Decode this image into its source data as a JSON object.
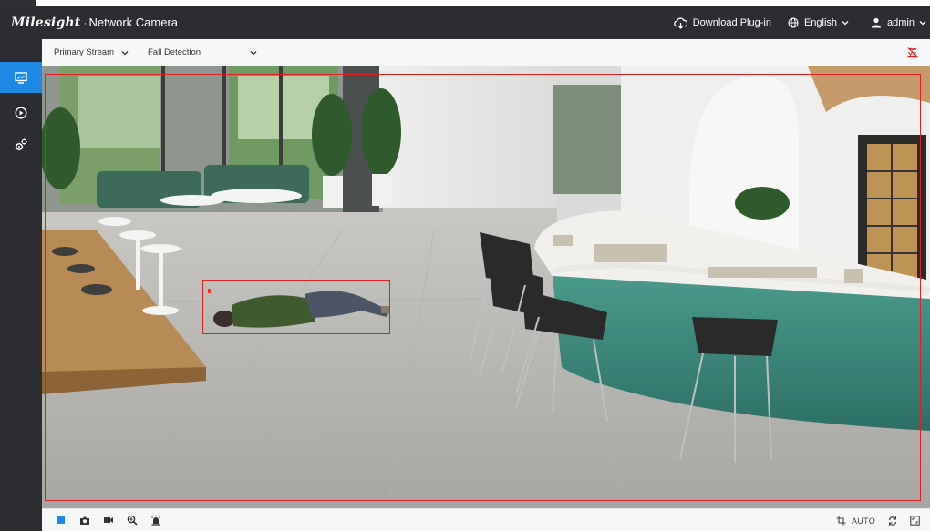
{
  "brand": {
    "logo": "Milesight",
    "product": "Network Camera"
  },
  "header": {
    "download_plugin": "Download Plug-in",
    "language": "English",
    "user": "admin"
  },
  "sidenav": {
    "items": [
      {
        "name": "live-view",
        "active": true
      },
      {
        "name": "playback",
        "active": false
      },
      {
        "name": "settings",
        "active": false
      }
    ]
  },
  "stream_bar": {
    "stream_select": "Primary Stream",
    "mode_select": "Fall Detection"
  },
  "bottom_bar": {
    "tools": [
      "stop-icon",
      "snapshot-icon",
      "record-icon",
      "zoom-icon",
      "alarm-icon"
    ],
    "ratio_label": "AUTO"
  },
  "colors": {
    "header_bg": "#2b2d31",
    "accent": "#1e88e5",
    "alert": "#e02020"
  }
}
